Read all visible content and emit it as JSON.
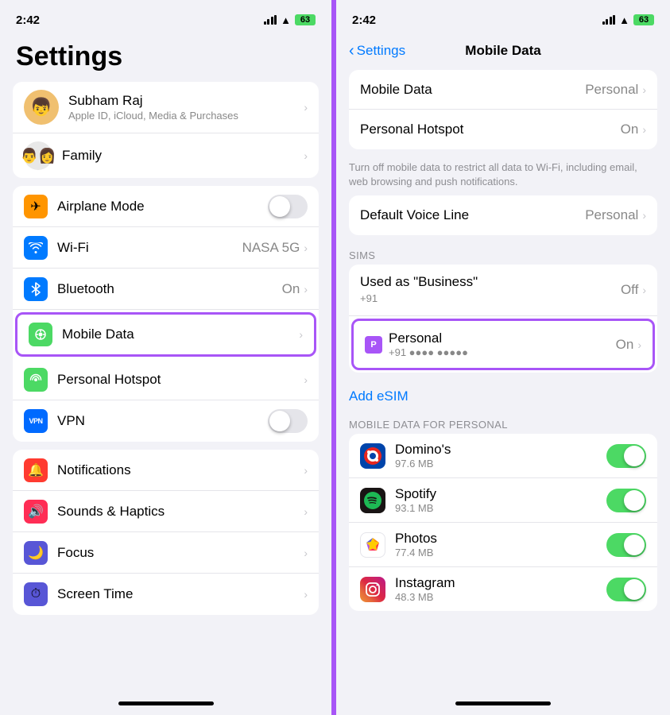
{
  "left": {
    "time": "2:42",
    "title": "Settings",
    "profile": {
      "name": "Subham Raj",
      "subtitle": "Apple ID, iCloud, Media & Purchases"
    },
    "family_label": "Family",
    "rows": [
      {
        "label": "Airplane Mode",
        "type": "toggle",
        "icon_color": "#ff9500",
        "icon": "✈"
      },
      {
        "label": "Wi-Fi",
        "value": "NASA 5G",
        "type": "chevron",
        "icon_color": "#007aff",
        "icon": "📶"
      },
      {
        "label": "Bluetooth",
        "value": "On",
        "type": "chevron",
        "icon_color": "#007aff",
        "icon": "🔵"
      },
      {
        "label": "Mobile Data",
        "type": "chevron",
        "icon_color": "#4cd964",
        "icon": "📡",
        "highlighted": true
      },
      {
        "label": "Personal Hotspot",
        "type": "chevron",
        "icon_color": "#4cd964",
        "icon": "🔗"
      },
      {
        "label": "VPN",
        "type": "toggle",
        "icon_color": "#006aff",
        "icon": "VPN"
      }
    ],
    "rows2": [
      {
        "label": "Notifications",
        "type": "chevron",
        "icon_color": "#ff3b30",
        "icon": "🔔"
      },
      {
        "label": "Sounds & Haptics",
        "type": "chevron",
        "icon_color": "#ff2d55",
        "icon": "🔊"
      },
      {
        "label": "Focus",
        "type": "chevron",
        "icon_color": "#5856d6",
        "icon": "🌙"
      },
      {
        "label": "Screen Time",
        "type": "chevron",
        "icon_color": "#5856d6",
        "icon": "⏱"
      }
    ]
  },
  "right": {
    "time": "2:42",
    "back_label": "Settings",
    "title": "Mobile Data",
    "sections": {
      "top": [
        {
          "label": "Mobile Data",
          "value": "Personal",
          "type": "chevron"
        },
        {
          "label": "Personal Hotspot",
          "value": "On",
          "type": "chevron"
        }
      ],
      "note": "Turn off mobile data to restrict all data to Wi-Fi, including email, web browsing and push notifications.",
      "voice": [
        {
          "label": "Default Voice Line",
          "value": "Personal",
          "type": "chevron"
        }
      ],
      "sims_label": "SIMs",
      "sims": [
        {
          "label": "Used as \"Business\"",
          "number": "+91",
          "value": "Off",
          "type": "chevron"
        },
        {
          "label": "Personal",
          "number": "+91 ●●●● ●●●●●",
          "value": "On",
          "type": "chevron",
          "highlighted": true
        }
      ],
      "add_esim": "Add eSIM",
      "apps_label": "MOBILE DATA FOR PERSONAL",
      "apps": [
        {
          "name": "Domino's",
          "size": "97.6 MB",
          "enabled": true,
          "icon_bg": "#1a1a2e",
          "icon": "🍕"
        },
        {
          "name": "Spotify",
          "size": "93.1 MB",
          "enabled": true,
          "icon_bg": "#1DB954",
          "icon": "🎵"
        },
        {
          "name": "Photos",
          "size": "77.4 MB",
          "enabled": true,
          "icon_bg": "#fff",
          "icon": "🌸"
        },
        {
          "name": "Instagram",
          "size": "48.3 MB",
          "enabled": true,
          "icon_bg": "#e1306c",
          "icon": "📷"
        }
      ]
    }
  }
}
